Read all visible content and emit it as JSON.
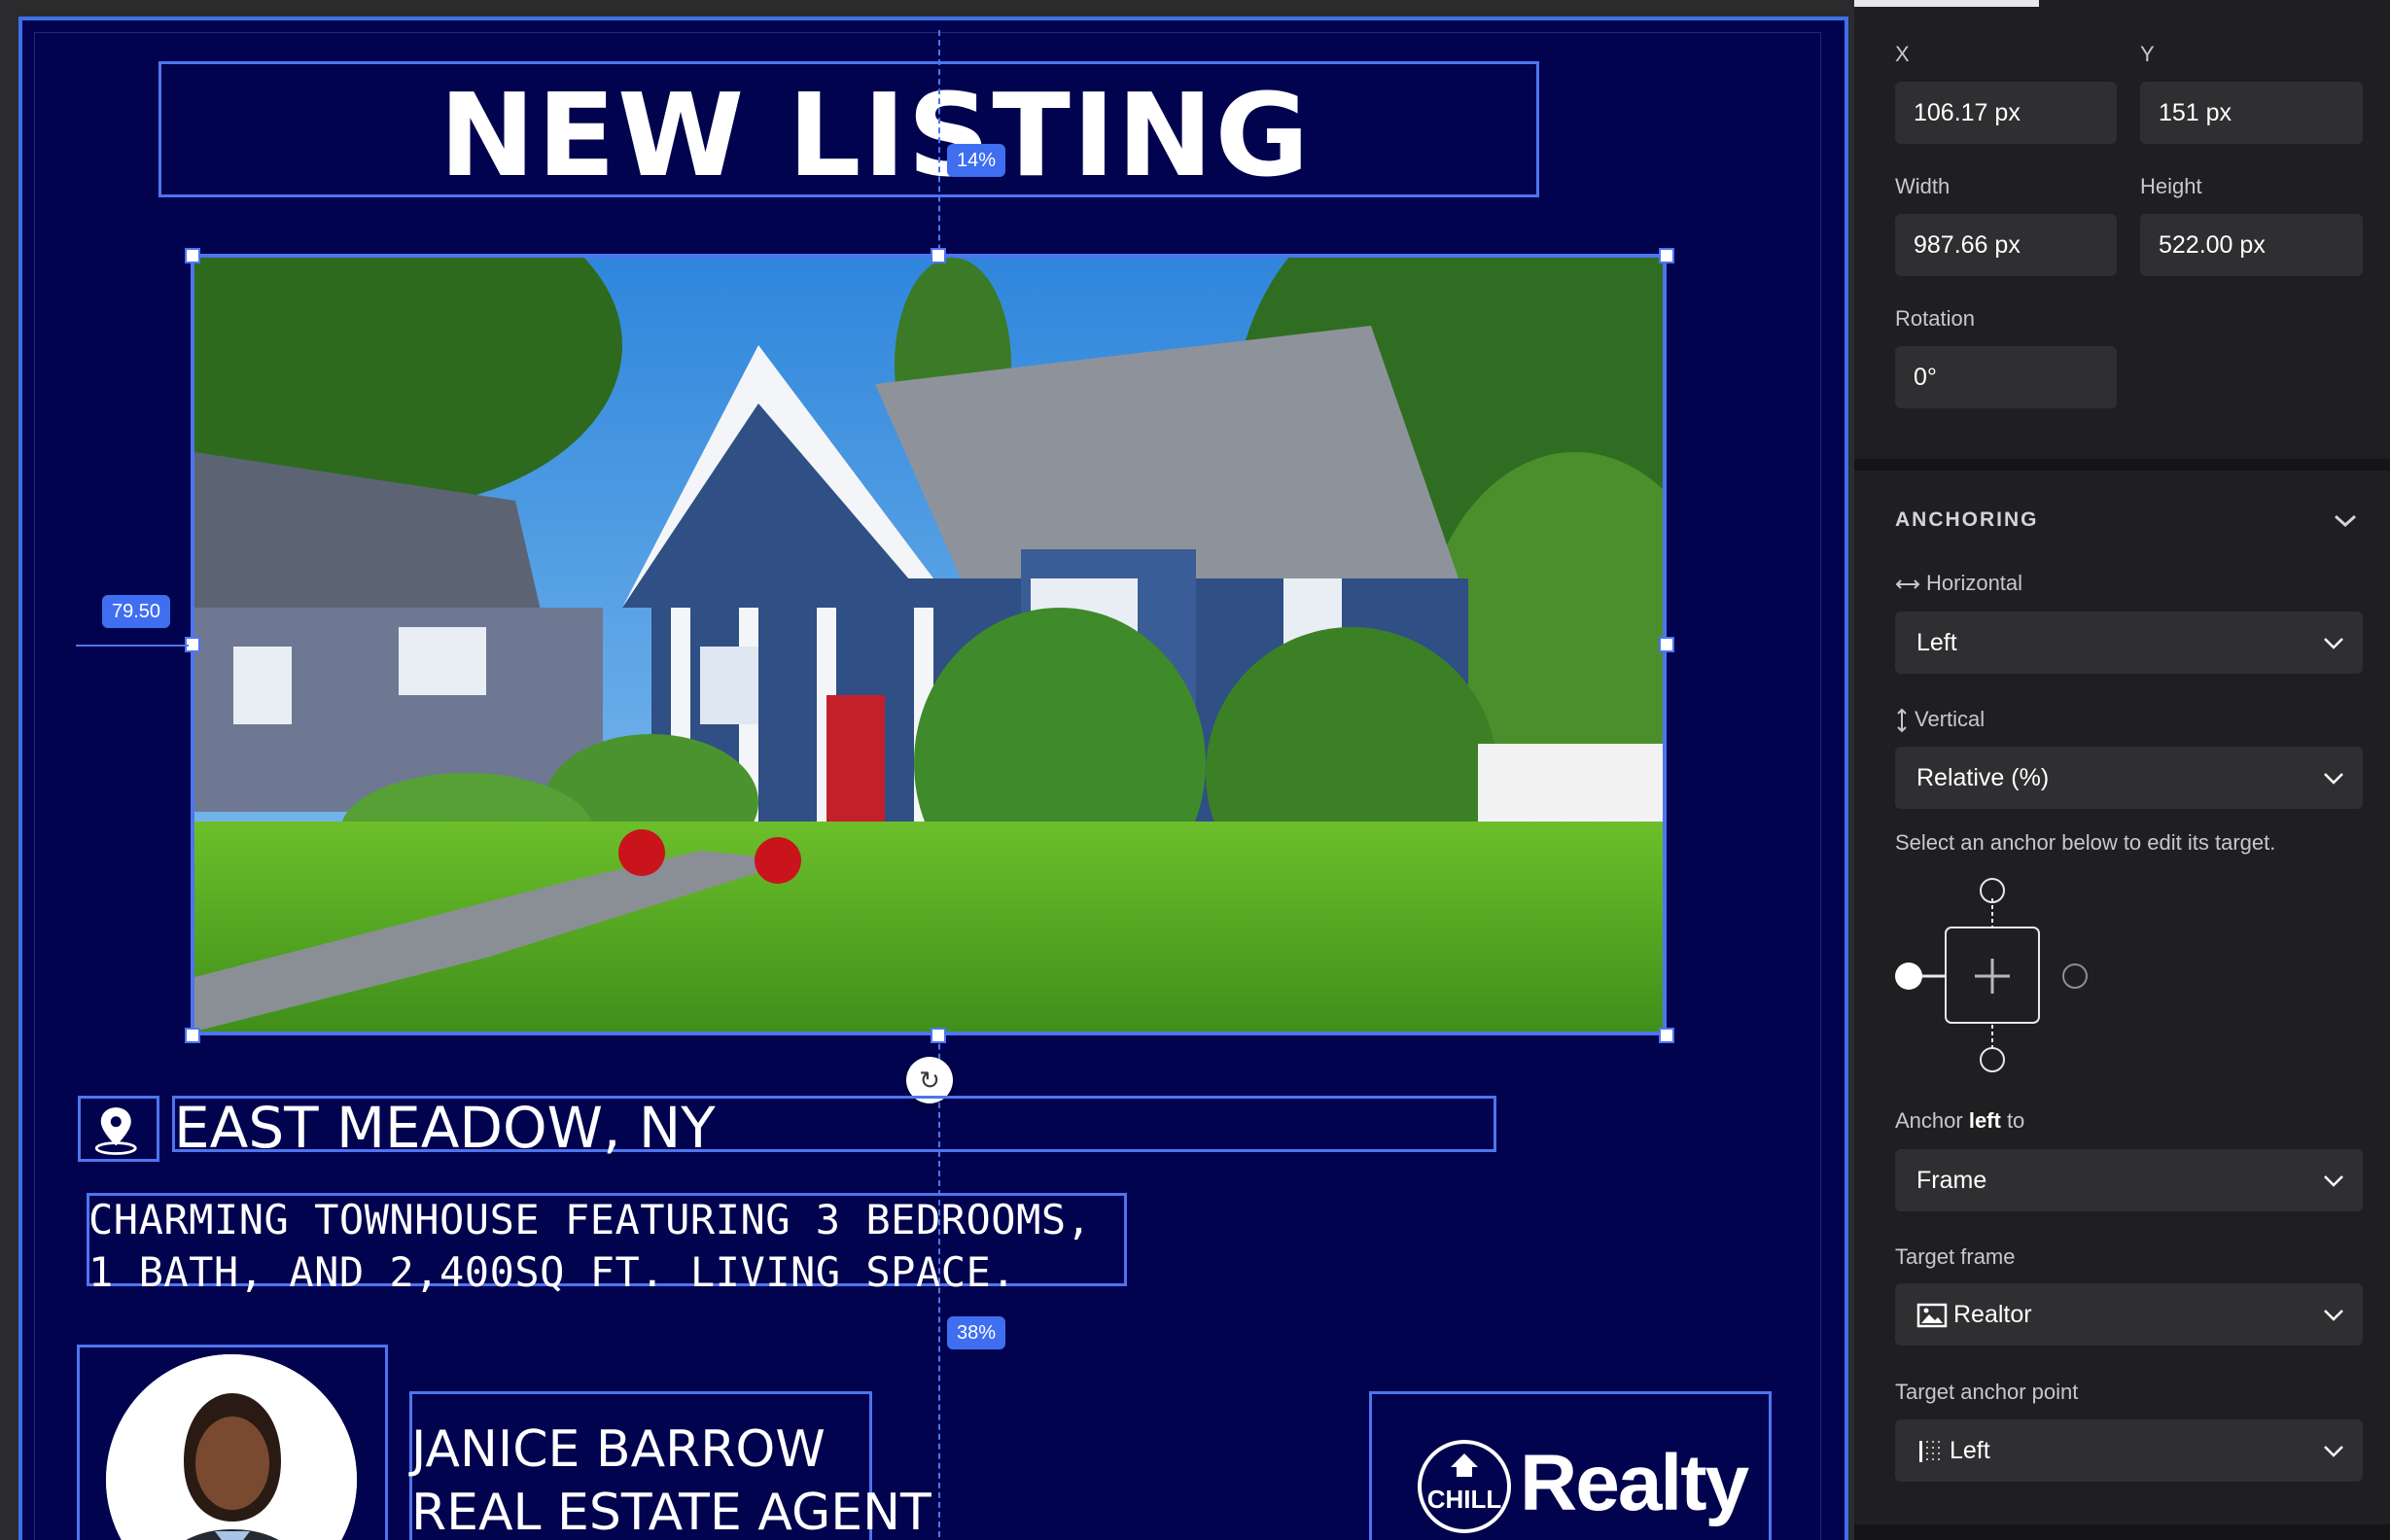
{
  "canvas": {
    "title": "NEW LISTING",
    "title_offset_badge": "14%",
    "left_offset_badge": "79.50",
    "bottom_offset_badge": "38%",
    "location": "EAST MEADOW, NY",
    "description": "CHARMING TOWNHOUSE FEATURING 3 BEDROOMS, 1 BATH, AND 2,400SQ FT. LIVING SPACE.",
    "agent_name": "JANICE BARROW",
    "agent_role": "REAL ESTATE AGENT",
    "brand_mark_text": "CHILL",
    "brand_name": "Realty",
    "background_color": "#01034e",
    "selection_color": "#4f74f0"
  },
  "panel": {
    "x_label": "X",
    "x_value": "106.17 px",
    "y_label": "Y",
    "y_value": "151 px",
    "width_label": "Width",
    "width_value": "987.66 px",
    "height_label": "Height",
    "height_value": "522.00 px",
    "rotation_label": "Rotation",
    "rotation_value": "0°",
    "anchoring_heading": "ANCHORING",
    "horizontal_label": "Horizontal",
    "horizontal_value": "Left",
    "vertical_label": "Vertical",
    "vertical_value": "Relative (%)",
    "anchor_hint": "Select an anchor below to edit its target.",
    "anchor_to_prefix": "Anchor ",
    "anchor_to_bold": "left",
    "anchor_to_suffix": " to",
    "anchor_to_value": "Frame",
    "target_frame_label": "Target frame",
    "target_frame_value": "Realtor",
    "target_point_label": "Target anchor point",
    "target_point_value": "Left"
  },
  "icons": [
    "map-pin-icon",
    "rotate-icon",
    "chevron-down-icon",
    "horizontal-arrows-icon",
    "vertical-arrows-icon",
    "image-icon",
    "grid-anchor-icon",
    "house-icon"
  ]
}
